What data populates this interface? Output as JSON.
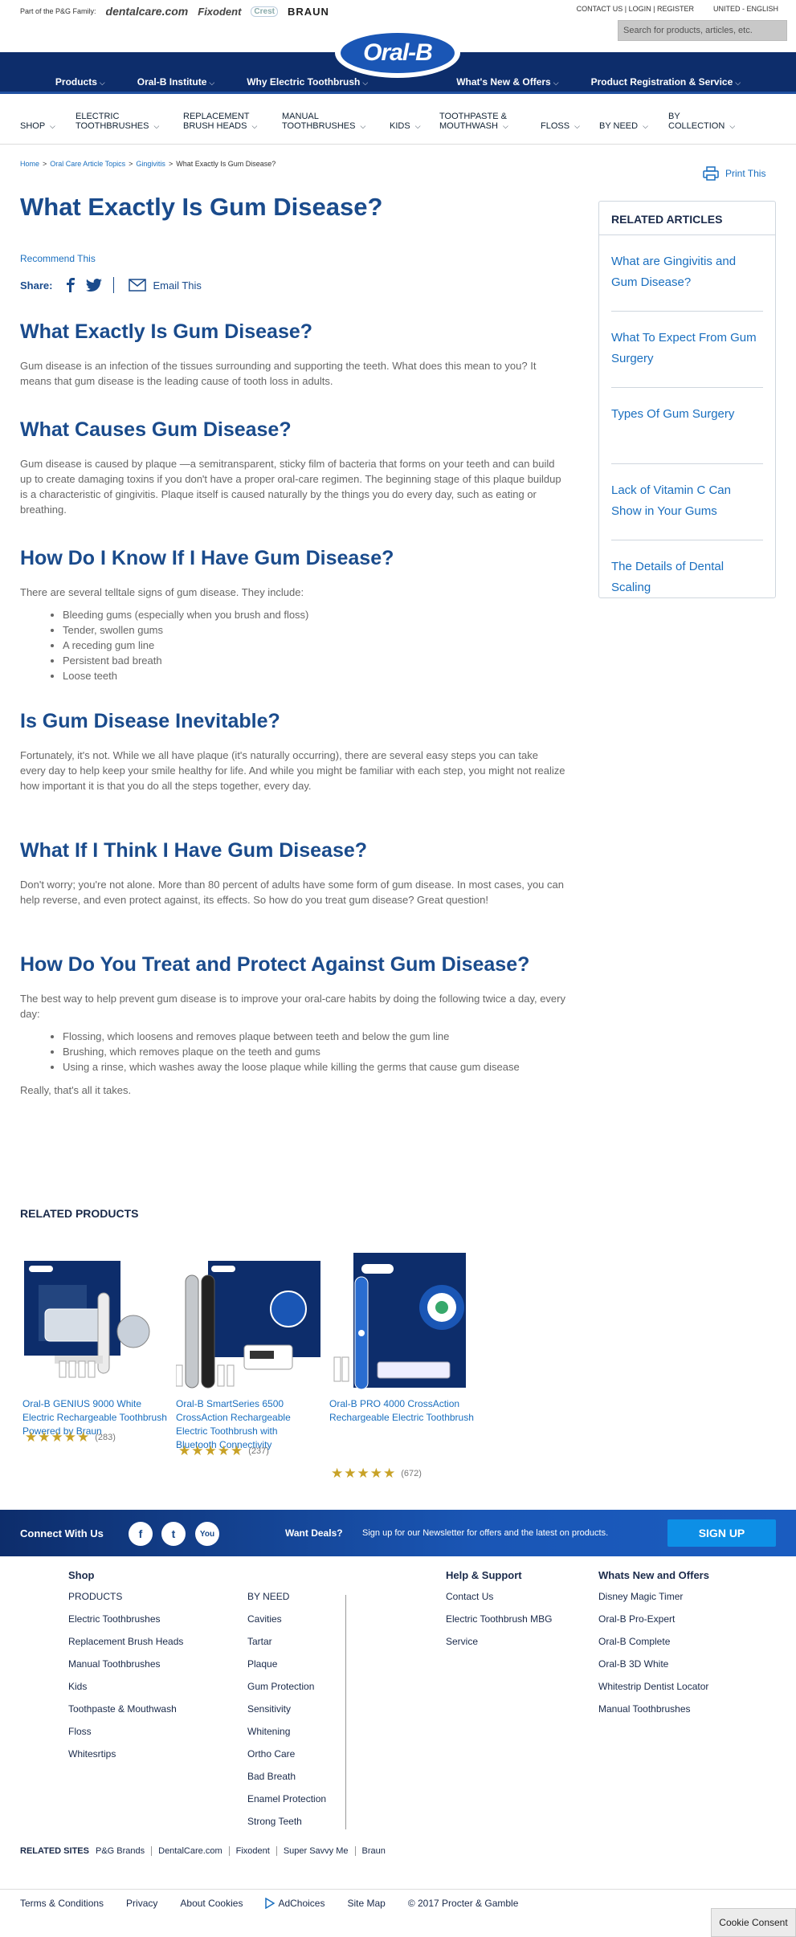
{
  "utility": {
    "family_label": "Part of the P&G Family:",
    "brands": [
      "dentalcare.com",
      "Fixodent",
      "Crest",
      "BRAUN"
    ],
    "contact": "CONTACT US",
    "login": "LOGIN",
    "register": "REGISTER",
    "locale": "UNITED - ENGLISH",
    "search_placeholder": "Search for products, articles, etc."
  },
  "logo_text": "Oral-B",
  "main_nav": [
    "Products",
    "Oral-B Institute",
    "Why Electric Toothbrush",
    "What's New & Offers",
    "Product Registration & Service"
  ],
  "sub_nav": [
    {
      "l1": "SHOP",
      "l2": ""
    },
    {
      "l1": "ELECTRIC",
      "l2": "TOOTHBRUSHES"
    },
    {
      "l1": "REPLACEMENT",
      "l2": "BRUSH HEADS"
    },
    {
      "l1": "MANUAL",
      "l2": "TOOTHBRUSHES"
    },
    {
      "l1": "KIDS",
      "l2": ""
    },
    {
      "l1": "TOOTHPASTE &",
      "l2": "MOUTHWASH"
    },
    {
      "l1": "FLOSS",
      "l2": ""
    },
    {
      "l1": "BY NEED",
      "l2": ""
    },
    {
      "l1": "BY",
      "l2": "COLLECTION"
    }
  ],
  "breadcrumb": {
    "items": [
      "Home",
      "Oral Care Article Topics",
      "Gingivitis"
    ],
    "current": "What Exactly Is Gum Disease?"
  },
  "print_label": "Print This",
  "article": {
    "title": "What Exactly Is Gum Disease?",
    "recommend": "Recommend This",
    "share_label": "Share:",
    "email_label": "Email This",
    "sections": [
      {
        "heading": "What Exactly Is Gum Disease?",
        "paragraphs": [
          "Gum disease is an infection of the tissues surrounding and supporting the teeth. What does this mean to you? It means that gum disease is the leading cause of tooth loss in adults."
        ]
      },
      {
        "heading": "What Causes Gum Disease?",
        "paragraphs": [
          "Gum disease is caused by plaque —a semitransparent, sticky film of bacteria that forms on your teeth and can build up to create damaging toxins if you don't have a proper oral-care regimen. The beginning stage of this plaque buildup is a characteristic of gingivitis. Plaque itself is caused naturally by the things you do every day, such as eating or breathing."
        ]
      },
      {
        "heading": "How Do I Know If I Have Gum Disease?",
        "paragraphs": [
          "There are several telltale signs of gum disease. They include:"
        ],
        "bullets": [
          "Bleeding gums (especially when you brush and floss)",
          "Tender, swollen gums",
          "A receding gum line",
          "Persistent bad breath",
          "Loose teeth"
        ]
      },
      {
        "heading": "Is Gum Disease Inevitable?",
        "paragraphs": [
          "Fortunately, it's not. While we all have plaque (it's naturally occurring), there are several easy steps you can take every day to help keep your smile healthy for life. And while you might be familiar with each step, you might not realize how important it is that you do all the steps together, every day."
        ]
      },
      {
        "heading": "What If I Think I Have Gum Disease?",
        "paragraphs": [
          "Don't worry; you're not alone. More than 80 percent of adults have some form of gum disease. In most cases, you can help reverse, and even protect against, its effects. So how do you treat gum disease? Great question!"
        ]
      },
      {
        "heading": "How Do You Treat and Protect Against Gum Disease?",
        "paragraphs": [
          "The best way to help prevent gum disease is to improve your oral-care habits by doing the following twice a day, every day:"
        ],
        "bullets": [
          "Flossing, which loosens and removes plaque between teeth and below the gum line",
          "Brushing, which removes plaque on the teeth and gums",
          "Using a rinse, which washes away the loose plaque while killing the germs that cause gum disease"
        ],
        "after": "Really, that's all it takes."
      }
    ]
  },
  "related_articles": {
    "heading": "RELATED ARTICLES",
    "items": [
      "What are Gingivitis and Gum Disease?",
      "What To Expect From Gum Surgery",
      "Types Of Gum Surgery",
      "Lack of Vitamin C Can Show in Your Gums",
      "The Details of Dental Scaling"
    ]
  },
  "related_products": {
    "heading": "RELATED PRODUCTS",
    "items": [
      {
        "name": "Oral-B GENIUS 9000 White Electric Rechargeable Toothbrush Powered by Braun",
        "stars": "★★★★★",
        "count": "(283)",
        "rating": 5
      },
      {
        "name": "Oral-B SmartSeries 6500 CrossAction Rechargeable Electric Toothbrush with Bluetooth Connectivity",
        "stars": "★★★★★",
        "count": "(237)",
        "rating": 5
      },
      {
        "name": "Oral-B PRO 4000 CrossAction Rechargeable Electric Toothbrush",
        "stars": "★★★★★",
        "count": "(672)",
        "rating": 5
      }
    ]
  },
  "connect": {
    "label": "Connect With Us",
    "social": [
      "f",
      "t",
      "You"
    ],
    "deals": "Want Deals?",
    "newsletter": "Sign up for our Newsletter for offers and the latest on products.",
    "signup": "SIGN UP"
  },
  "footer": {
    "shop": {
      "heading": "Shop",
      "items": [
        "PRODUCTS",
        "Electric Toothbrushes",
        "Replacement Brush Heads",
        "Manual Toothbrushes",
        "Kids",
        "Toothpaste & Mouthwash",
        "Floss",
        "Whitesrtips"
      ]
    },
    "need": {
      "items": [
        "BY NEED",
        "Cavities",
        "Tartar",
        "Plaque",
        "Gum Protection",
        "Sensitivity",
        "Whitening",
        "Ortho Care",
        "Bad Breath",
        "Enamel Protection",
        "Strong Teeth"
      ]
    },
    "help": {
      "heading": "Help & Support",
      "items": [
        "Contact Us",
        "Electric Toothbrush MBG",
        "Service"
      ]
    },
    "whats_new": {
      "heading": "Whats New and Offers",
      "items": [
        "Disney Magic Timer",
        "Oral-B Pro-Expert",
        "Oral-B Complete",
        "Oral-B 3D White",
        "Whitestrip Dentist Locator",
        "Manual Toothbrushes"
      ]
    }
  },
  "related_sites": {
    "heading": "RELATED SITES",
    "items": [
      "P&G Brands",
      "DentalCare.com",
      "Fixodent",
      "Super Savvy Me",
      "Braun"
    ]
  },
  "legal": {
    "items": [
      "Terms & Conditions",
      "Privacy",
      "About Cookies",
      "AdChoices",
      "Site Map",
      "© 2017 Procter & Gamble"
    ]
  },
  "cookie_label": "Cookie Consent",
  "colors": {
    "brand_navy": "#0d2d6b",
    "heading_blue": "#1a4b8c",
    "link_blue": "#1a6fbf",
    "star_gold": "#c8a227",
    "signup_blue": "#0d8fe6"
  }
}
